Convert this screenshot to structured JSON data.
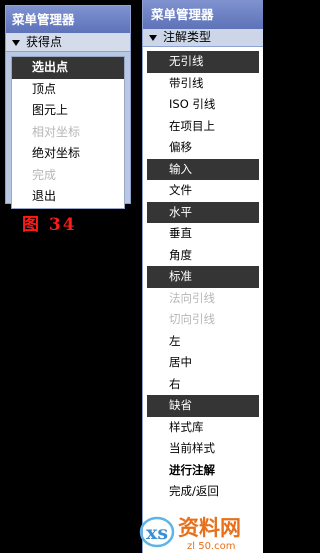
{
  "left_menu": {
    "title": "菜单管理器",
    "subtitle": "获得点",
    "items": [
      {
        "label": "选出点",
        "state": "selected"
      },
      {
        "label": "顶点",
        "state": "normal"
      },
      {
        "label": "图元上",
        "state": "normal"
      },
      {
        "label": "相对坐标",
        "state": "disabled"
      },
      {
        "label": "绝对坐标",
        "state": "normal"
      },
      {
        "label": "完成",
        "state": "disabled"
      },
      {
        "label": "退出",
        "state": "normal"
      }
    ]
  },
  "figure_caption": "图 34",
  "right_menu": {
    "title": "菜单管理器",
    "subtitle": "注解类型",
    "items": [
      {
        "label": "无引线",
        "state": "selected"
      },
      {
        "label": "带引线",
        "state": "normal"
      },
      {
        "label": "ISO 引线",
        "state": "normal"
      },
      {
        "label": "在项目上",
        "state": "normal"
      },
      {
        "label": "偏移",
        "state": "normal"
      },
      {
        "label": "输入",
        "state": "selected"
      },
      {
        "label": "文件",
        "state": "normal"
      },
      {
        "label": "水平",
        "state": "selected"
      },
      {
        "label": "垂直",
        "state": "normal"
      },
      {
        "label": "角度",
        "state": "normal"
      },
      {
        "label": "标准",
        "state": "selected"
      },
      {
        "label": "法向引线",
        "state": "disabled"
      },
      {
        "label": "切向引线",
        "state": "disabled"
      },
      {
        "label": "左",
        "state": "normal"
      },
      {
        "label": "居中",
        "state": "normal"
      },
      {
        "label": "右",
        "state": "normal"
      },
      {
        "label": "缺省",
        "state": "selected"
      },
      {
        "label": "样式库",
        "state": "normal"
      },
      {
        "label": "当前样式",
        "state": "normal"
      },
      {
        "label": "进行注解",
        "state": "bold"
      },
      {
        "label": "完成/返回",
        "state": "normal"
      }
    ]
  },
  "watermark": {
    "line1": "资料网",
    "line2": "zl 50.com"
  },
  "colors": {
    "title_bar": "#5d72b8",
    "selected_bg": "#353535",
    "caption_red": "#ff1a1a"
  }
}
